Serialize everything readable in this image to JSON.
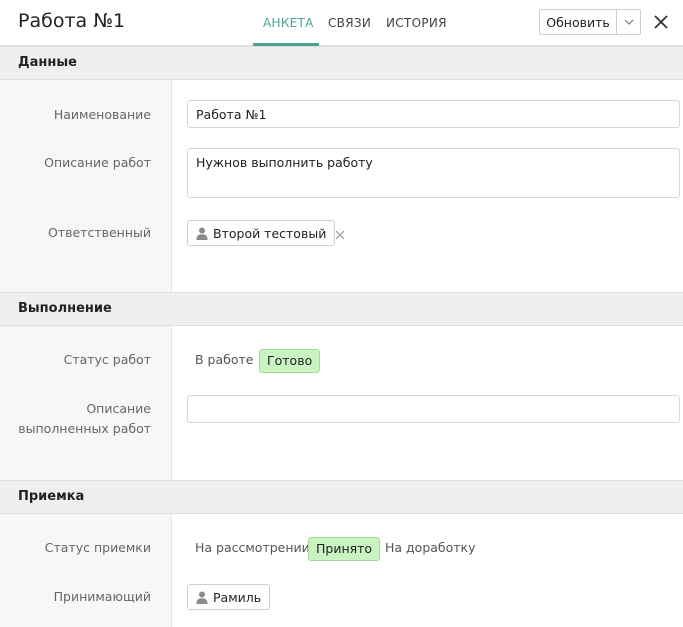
{
  "header": {
    "title": "Работа №1",
    "tabs": [
      {
        "label": "АНКЕТА",
        "active": true
      },
      {
        "label": "СВЯЗИ",
        "active": false
      },
      {
        "label": "ИСТОРИЯ",
        "active": false
      }
    ],
    "update_label": "Обновить",
    "icons": [
      "chevron-down-icon",
      "close-icon"
    ]
  },
  "sections": {
    "data": {
      "title": "Данные",
      "name_label": "Наименование",
      "name_value": "Работа №1",
      "description_label": "Описание работ",
      "description_value": "Нужнов выполнить работу",
      "responsible_label": "Ответственный",
      "responsible_value": "Второй тестовый"
    },
    "execution": {
      "title": "Выполнение",
      "status_label": "Статус работ",
      "status_options": [
        "В работе",
        "Готово"
      ],
      "status_selected": "Готово",
      "done_desc_label_line1": "Описание",
      "done_desc_label_line2": "выполненных работ",
      "done_desc_value": ""
    },
    "acceptance": {
      "title": "Приемка",
      "status_label": "Статус приемки",
      "status_options": [
        "На рассмотрении",
        "Принято",
        "На доработку"
      ],
      "status_selected": "Принято",
      "acceptor_label": "Принимающий",
      "acceptor_value": "Рамиль"
    }
  },
  "colors": {
    "accent": "#4aa394",
    "selected_bg": "#c9f4c1",
    "section_bg": "#efefef",
    "label_col_bg": "#f7f7f7"
  }
}
